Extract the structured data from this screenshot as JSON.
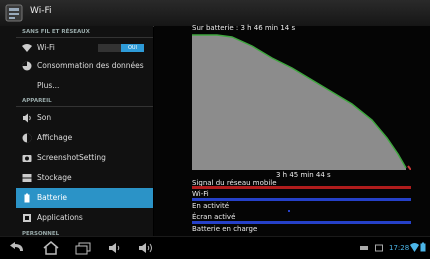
{
  "header": {
    "title": "Wi-Fi"
  },
  "sections": {
    "wireless": "SANS FIL ET RÉSEAUX",
    "device": "APPAREIL",
    "personal": "PERSONNEL"
  },
  "wifi_item": {
    "label": "Wi-Fi",
    "toggle": "OUI"
  },
  "items": {
    "data_usage": "Consommation des données",
    "more": "Plus...",
    "sound": "Son",
    "display": "Affichage",
    "screenshot": "ScreenshotSetting",
    "storage": "Stockage",
    "battery": "Batterie",
    "apps": "Applications"
  },
  "battery": {
    "on_battery": "Sur batterie : 3 h 46 min 14 s",
    "elapsed": "3 h 45 min 44 s",
    "signals": {
      "mobile": "Signal du réseau mobile",
      "wifi": "Wi-Fi",
      "awake": "En activité",
      "screen": "Écran activé",
      "charging": "Batterie en charge"
    }
  },
  "status": {
    "time": "17:28"
  },
  "colors": {
    "accent": "#2b93c7",
    "graph_fill": "#8c8c8c",
    "graph_line": "#3fa63f",
    "mobile_bar": "#b01c1c",
    "wifi_bar": "#2540c8"
  }
}
